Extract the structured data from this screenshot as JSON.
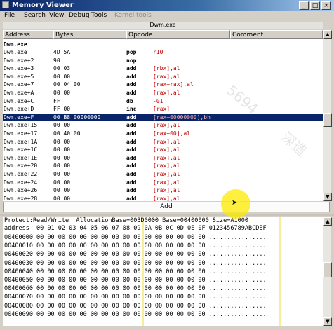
{
  "window": {
    "title": "Memory Viewer",
    "min": "_",
    "max": "□",
    "close": "×"
  },
  "menu": {
    "file": "File",
    "search": "Search",
    "view": "View",
    "debug": "Debug",
    "tools": "Tools",
    "kernel_tools": "Kernel tools"
  },
  "disasm": {
    "module_title": "Dwm.exe",
    "headers": {
      "address": "Address",
      "bytes": "Bytes",
      "opcode": "Opcode",
      "comment": "Comment"
    },
    "section": "Dwm.exe",
    "rows": [
      {
        "addr": "Dwm.exe",
        "bytes": "4D 5A",
        "op": "pop",
        "arg": "r10",
        "sel": false
      },
      {
        "addr": "Dwm.exe+2",
        "bytes": "90",
        "op": "nop",
        "arg": "",
        "sel": false
      },
      {
        "addr": "Dwm.exe+3",
        "bytes": "00 03",
        "op": "add",
        "arg": "[rbx],al",
        "sel": false
      },
      {
        "addr": "Dwm.exe+5",
        "bytes": "00 00",
        "op": "add",
        "arg": "[rax],al",
        "sel": false
      },
      {
        "addr": "Dwm.exe+7",
        "bytes": "00 04 00",
        "op": "add",
        "arg": "[rax+rax],al",
        "sel": false
      },
      {
        "addr": "Dwm.exe+A",
        "bytes": "00 00",
        "op": "add",
        "arg": "[rax],al",
        "sel": false
      },
      {
        "addr": "Dwm.exe+C",
        "bytes": "FF",
        "op": "db",
        "arg": "-01",
        "sel": false
      },
      {
        "addr": "Dwm.exe+D",
        "bytes": "FF 00",
        "op": "inc",
        "arg": "[rax]",
        "sel": false
      },
      {
        "addr": "Dwm.exe+F",
        "bytes": "00 B8 00000000",
        "op": "add",
        "arg": "[rax+00000000],bh",
        "sel": true
      },
      {
        "addr": "Dwm.exe+15",
        "bytes": "00 00",
        "op": "add",
        "arg": "[rax],al",
        "sel": false
      },
      {
        "addr": "Dwm.exe+17",
        "bytes": "00 40 00",
        "op": "add",
        "arg": "[rax+00],al",
        "sel": false
      },
      {
        "addr": "Dwm.exe+1A",
        "bytes": "00 00",
        "op": "add",
        "arg": "[rax],al",
        "sel": false
      },
      {
        "addr": "Dwm.exe+1C",
        "bytes": "00 00",
        "op": "add",
        "arg": "[rax],al",
        "sel": false
      },
      {
        "addr": "Dwm.exe+1E",
        "bytes": "00 00",
        "op": "add",
        "arg": "[rax],al",
        "sel": false
      },
      {
        "addr": "Dwm.exe+20",
        "bytes": "00 00",
        "op": "add",
        "arg": "[rax],al",
        "sel": false
      },
      {
        "addr": "Dwm.exe+22",
        "bytes": "00 00",
        "op": "add",
        "arg": "[rax],al",
        "sel": false
      },
      {
        "addr": "Dwm.exe+24",
        "bytes": "00 00",
        "op": "add",
        "arg": "[rax],al",
        "sel": false
      },
      {
        "addr": "Dwm.exe+26",
        "bytes": "00 00",
        "op": "add",
        "arg": "[rax],al",
        "sel": false
      },
      {
        "addr": "Dwm.exe+28",
        "bytes": "00 00",
        "op": "add",
        "arg": "[rax],al",
        "sel": false
      }
    ],
    "add_button": "Add"
  },
  "hexview": {
    "info": "Protect:Read/Write  AllocationBase=003D0000 Base=00400000 Size=A1000",
    "header": "address  00 01 02 03 04 05 06 07 08 09 0A 0B 0C 0D 0E 0F 0123456789ABCDEF",
    "rows": [
      "00400000 00 00 00 00 00 00 00 00 00 00 00 00 00 00 00 00 ................",
      "00400010 00 00 00 00 00 00 00 00 00 00 00 00 00 00 00 00 ................",
      "00400020 00 00 00 00 00 00 00 00 00 00 00 00 00 00 00 00 ................",
      "00400030 00 00 00 00 00 00 00 00 00 00 00 00 00 00 00 00 ................",
      "00400040 00 00 00 00 00 00 00 00 00 00 00 00 00 00 00 00 ................",
      "00400050 00 00 00 00 00 00 00 00 00 00 00 00 00 00 00 00 ................",
      "00400060 00 00 00 00 00 00 00 00 00 00 00 00 00 00 00 00 ................",
      "00400070 00 00 00 00 00 00 00 00 00 00 00 00 00 00 00 00 ................",
      "00400080 00 00 00 00 00 00 00 00 00 00 00 00 00 00 00 00 ................",
      "00400090 00 00 00 00 00 00 00 00 00 00 00 00 00 00 00 00 ................"
    ]
  },
  "watermarks": [
    "5694",
    "深造"
  ],
  "colors": {
    "selection": "#0a246a",
    "operand": "#c00000",
    "highlight": "#f5ef9a"
  }
}
